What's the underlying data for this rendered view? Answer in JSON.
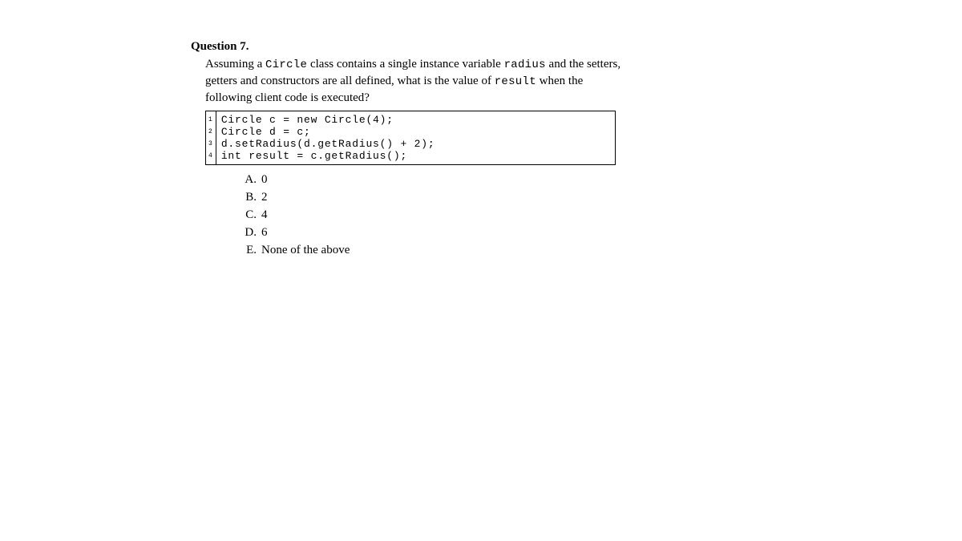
{
  "question": {
    "label": "Question 7.",
    "prompt_parts": {
      "p1": "Assuming a ",
      "m1": "Circle",
      "p2": " class contains a single instance variable ",
      "m2": "radius",
      "p3": " and the setters, getters and constructors are all defined, what is the value of ",
      "m3": "result",
      "p4": " when the following client code is executed?"
    }
  },
  "code": {
    "lines": [
      "Circle c = new Circle(4);",
      "Circle d = c;",
      "d.setRadius(d.getRadius() + 2);",
      "int result = c.getRadius();"
    ],
    "numbers": [
      "1",
      "2",
      "3",
      "4"
    ]
  },
  "options": [
    {
      "letter": "A.",
      "text": "0"
    },
    {
      "letter": "B.",
      "text": "2"
    },
    {
      "letter": "C.",
      "text": "4"
    },
    {
      "letter": "D.",
      "text": "6"
    },
    {
      "letter": "E.",
      "text": "None of the above"
    }
  ]
}
